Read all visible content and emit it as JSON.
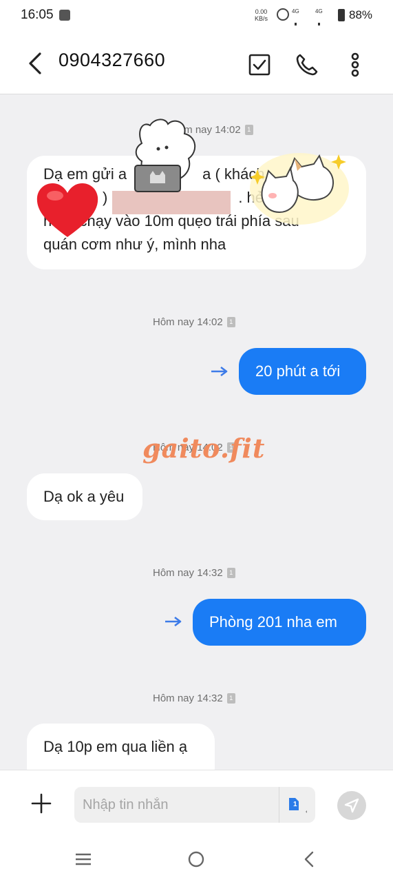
{
  "status_bar": {
    "time": "16:05",
    "net_speed_value": "0.00",
    "net_speed_unit": "KB/s",
    "network_1": "4G",
    "network_2": "4G",
    "battery": "88%"
  },
  "header": {
    "title": "0904327660",
    "icons": [
      "back-icon",
      "checklist-icon",
      "phone-icon",
      "more-icon"
    ]
  },
  "messages": [
    {
      "timestamp": "Hôm nay 14:02",
      "direction": "incoming",
      "lines": [
        "Dạ em gửi a",
        "a ( khách",
        ")",
        ". hẻ",
        "hẻ",
        "chạy vào 10m quẹo trái phía sau",
        "quán cơm như ý, mình nha"
      ]
    },
    {
      "timestamp": "Hôm nay 14:02",
      "direction": "outgoing",
      "text": "20 phút a tới"
    },
    {
      "timestamp": "Hôm nay 14:02",
      "direction": "incoming",
      "text": "Dạ ok a yêu"
    },
    {
      "timestamp": "Hôm nay 14:32",
      "direction": "outgoing",
      "text": "Phòng 201 nha em"
    },
    {
      "timestamp": "Hôm nay 14:32",
      "direction": "incoming",
      "text": "Dạ 10p em qua liền ạ"
    }
  ],
  "sim_badge": "1",
  "watermark": "gaito.fit",
  "composer": {
    "placeholder": "Nhập tin nhắn",
    "sim_label": "1"
  },
  "colors": {
    "outgoing_bubble": "#1a7cf5",
    "incoming_bubble": "#ffffff",
    "background": "#f0f0f2",
    "watermark": "#f08a5d"
  }
}
